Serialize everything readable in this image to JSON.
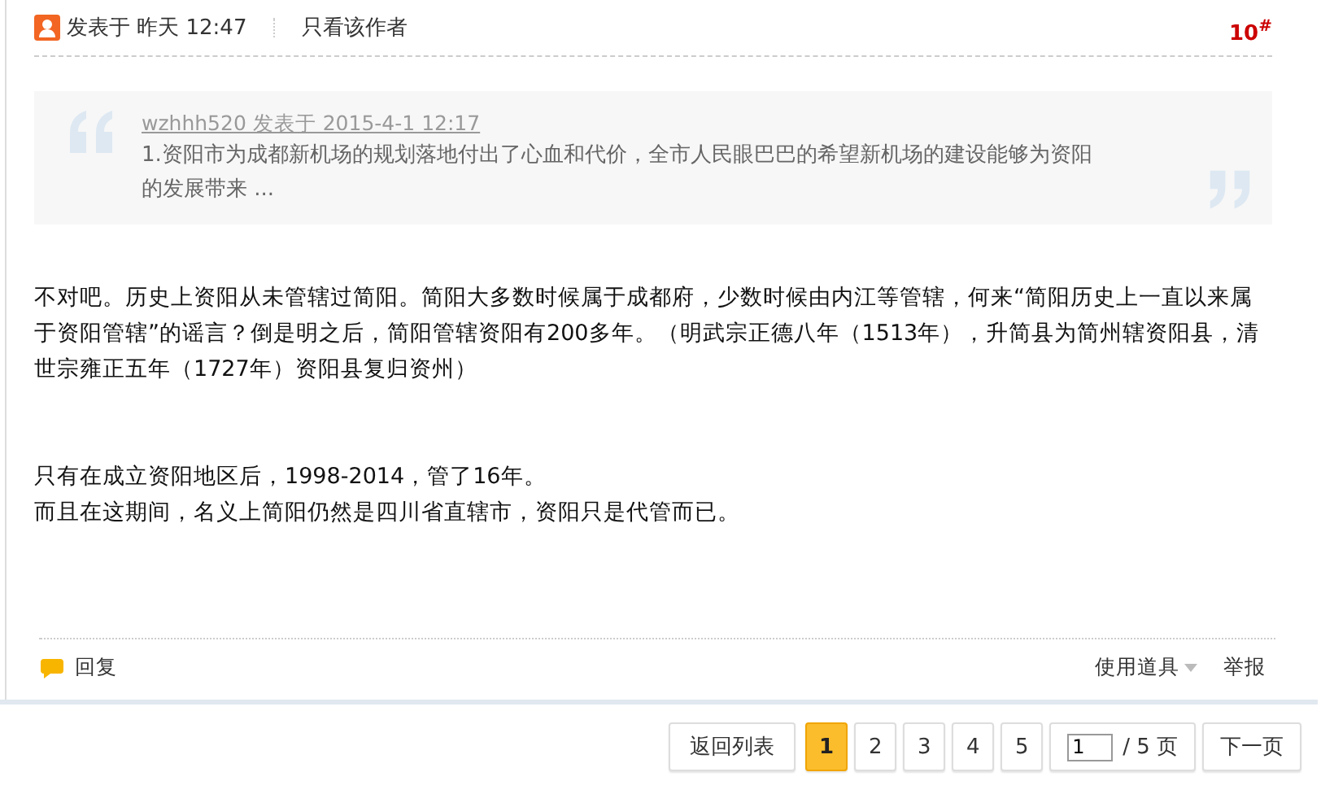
{
  "post": {
    "meta": "发表于 昨天 12:47",
    "author_only": "只看该作者",
    "floor": "10",
    "floor_mark": "#"
  },
  "quote": {
    "byline": "wzhhh520 发表于 2015-4-1 12:17",
    "text": "1.资阳市为成都新机场的规划落地付出了心血和代价，全市人民眼巴巴的希望新机场的建设能够为资阳的发展带来 ..."
  },
  "body": {
    "blocks": [
      [
        "不对吧。历史上资阳从未管辖过简阳。简阳大多数时候属于成都府，少数时候由内江等管辖，何来“简阳历史上一直以来属于资阳管辖”的谣言？倒是明之后，简阳管辖资阳有200多年。（明武宗正德八年（1513年），升简县为简州辖资阳县，清世宗雍正五年（1727年）资阳县复归资州）"
      ],
      [
        "只有在成立资阳地区后，1998-2014，管了16年。",
        "而且在这期间，名义上简阳仍然是四川省直辖市，资阳只是代管而已。"
      ]
    ]
  },
  "actions": {
    "reply": "回复",
    "tools": "使用道具",
    "report": "举报"
  },
  "pager": {
    "back": "返回列表",
    "pages": [
      {
        "label": "1",
        "selected": true
      },
      {
        "label": "2",
        "selected": false
      },
      {
        "label": "3",
        "selected": false
      },
      {
        "label": "4",
        "selected": false
      },
      {
        "label": "5",
        "selected": false
      }
    ],
    "page_input": "1",
    "total": "/ 5 页",
    "next": "下一页"
  }
}
